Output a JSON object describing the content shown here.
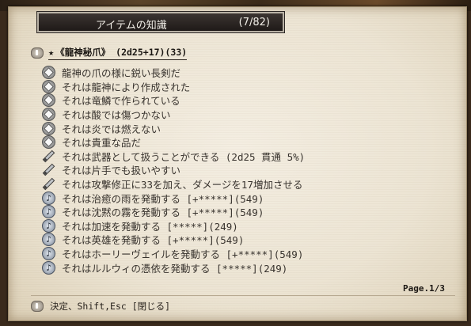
{
  "window": {
    "title": "アイテムの知識",
    "count": "(7/82)"
  },
  "item": {
    "title": "《龍神秘爪》 (2d25+17)(33)"
  },
  "lines": [
    {
      "icon": "diamond",
      "text": "龍神の爪の様に鋭い長剣だ"
    },
    {
      "icon": "diamond",
      "text": "それは龍神により作成された"
    },
    {
      "icon": "diamond",
      "text": "それは竜鱗で作られている"
    },
    {
      "icon": "diamond",
      "text": "それは酸では傷つかない"
    },
    {
      "icon": "diamond",
      "text": "それは炎では燃えない"
    },
    {
      "icon": "diamond",
      "text": "それは貴重な品だ"
    },
    {
      "icon": "sword",
      "text": "それは武器として扱うことができる (2d25 貫通 5%)"
    },
    {
      "icon": "sword",
      "text": "それは片手でも扱いやすい"
    },
    {
      "icon": "sword",
      "text": "それは攻撃修正に33を加え、ダメージを17増加させる"
    },
    {
      "icon": "note",
      "text": "それは治癒の雨を発動する [+*****](549)"
    },
    {
      "icon": "note",
      "text": "それは沈黙の霧を発動する [+*****](549)"
    },
    {
      "icon": "note",
      "text": "それは加速を発動する [*****](249)"
    },
    {
      "icon": "note",
      "text": "それは英雄を発動する [+*****](549)"
    },
    {
      "icon": "note",
      "text": "それはホーリーヴェイルを発動する [+*****](549)"
    },
    {
      "icon": "note",
      "text": "それはルルウィの憑依を発動する [*****](249)"
    }
  ],
  "footer": {
    "page": "Page.1/3",
    "hint": "決定、Shift,Esc [閉じる]"
  }
}
